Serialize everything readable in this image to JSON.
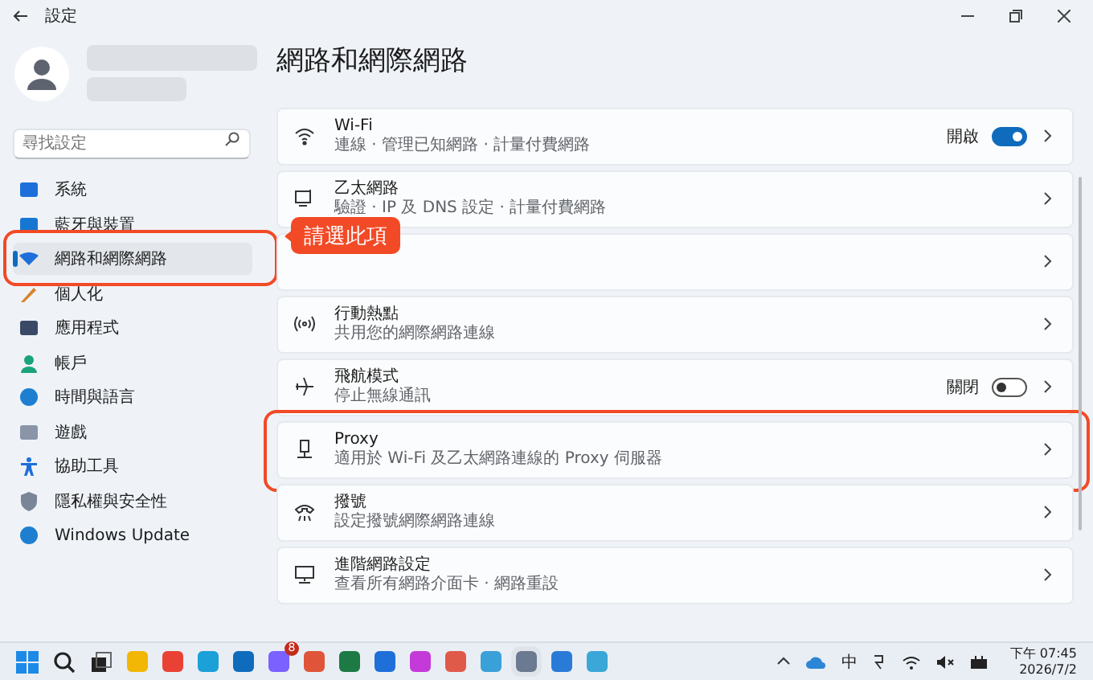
{
  "window": {
    "title": "設定"
  },
  "search": {
    "placeholder": "尋找設定"
  },
  "sidebar": {
    "items": [
      {
        "label": "系統",
        "selected": false,
        "highlighted": false
      },
      {
        "label": "藍牙與裝置",
        "selected": false,
        "highlighted": false
      },
      {
        "label": "網路和網際網路",
        "selected": true,
        "highlighted": true
      },
      {
        "label": "個人化",
        "selected": false,
        "highlighted": false
      },
      {
        "label": "應用程式",
        "selected": false,
        "highlighted": false
      },
      {
        "label": "帳戶",
        "selected": false,
        "highlighted": false
      },
      {
        "label": "時間與語言",
        "selected": false,
        "highlighted": false
      },
      {
        "label": "遊戲",
        "selected": false,
        "highlighted": false
      },
      {
        "label": "協助工具",
        "selected": false,
        "highlighted": false
      },
      {
        "label": "隱私權與安全性",
        "selected": false,
        "highlighted": false
      },
      {
        "label": "Windows Update",
        "selected": false,
        "highlighted": false
      }
    ]
  },
  "page_title": "網路和網際網路",
  "callout": "請選此項",
  "cards": [
    {
      "kind": "wifi",
      "title": "Wi-Fi",
      "subtitle": "連線 · 管理已知網路 · 計量付費網路",
      "toggle": {
        "label": "開啟",
        "on": true
      },
      "highlighted": false
    },
    {
      "kind": "ethernet",
      "title": "乙太網路",
      "subtitle": "驗證 · IP 及 DNS 設定 · 計量付費網路",
      "highlighted": false
    },
    {
      "kind": "hidden",
      "highlighted": false
    },
    {
      "kind": "hotspot",
      "title": "行動熱點",
      "subtitle": "共用您的網際網路連線",
      "highlighted": false
    },
    {
      "kind": "airplane",
      "title": "飛航模式",
      "subtitle": "停止無線通訊",
      "toggle": {
        "label": "關閉",
        "on": false
      },
      "highlighted": false
    },
    {
      "kind": "proxy",
      "title": "Proxy",
      "subtitle": "適用於 Wi-Fi 及乙太網路連線的 Proxy 伺服器",
      "highlighted": true
    },
    {
      "kind": "dialup",
      "title": "撥號",
      "subtitle": "設定撥號網際網路連線",
      "highlighted": false
    },
    {
      "kind": "advanced",
      "title": "進階網路設定",
      "subtitle": "查看所有網路介面卡 · 網路重設",
      "highlighted": false
    }
  ],
  "taskbar": {
    "badge": "8",
    "ime": "中",
    "time": "下午 07:45",
    "date": "2026/7/2"
  }
}
